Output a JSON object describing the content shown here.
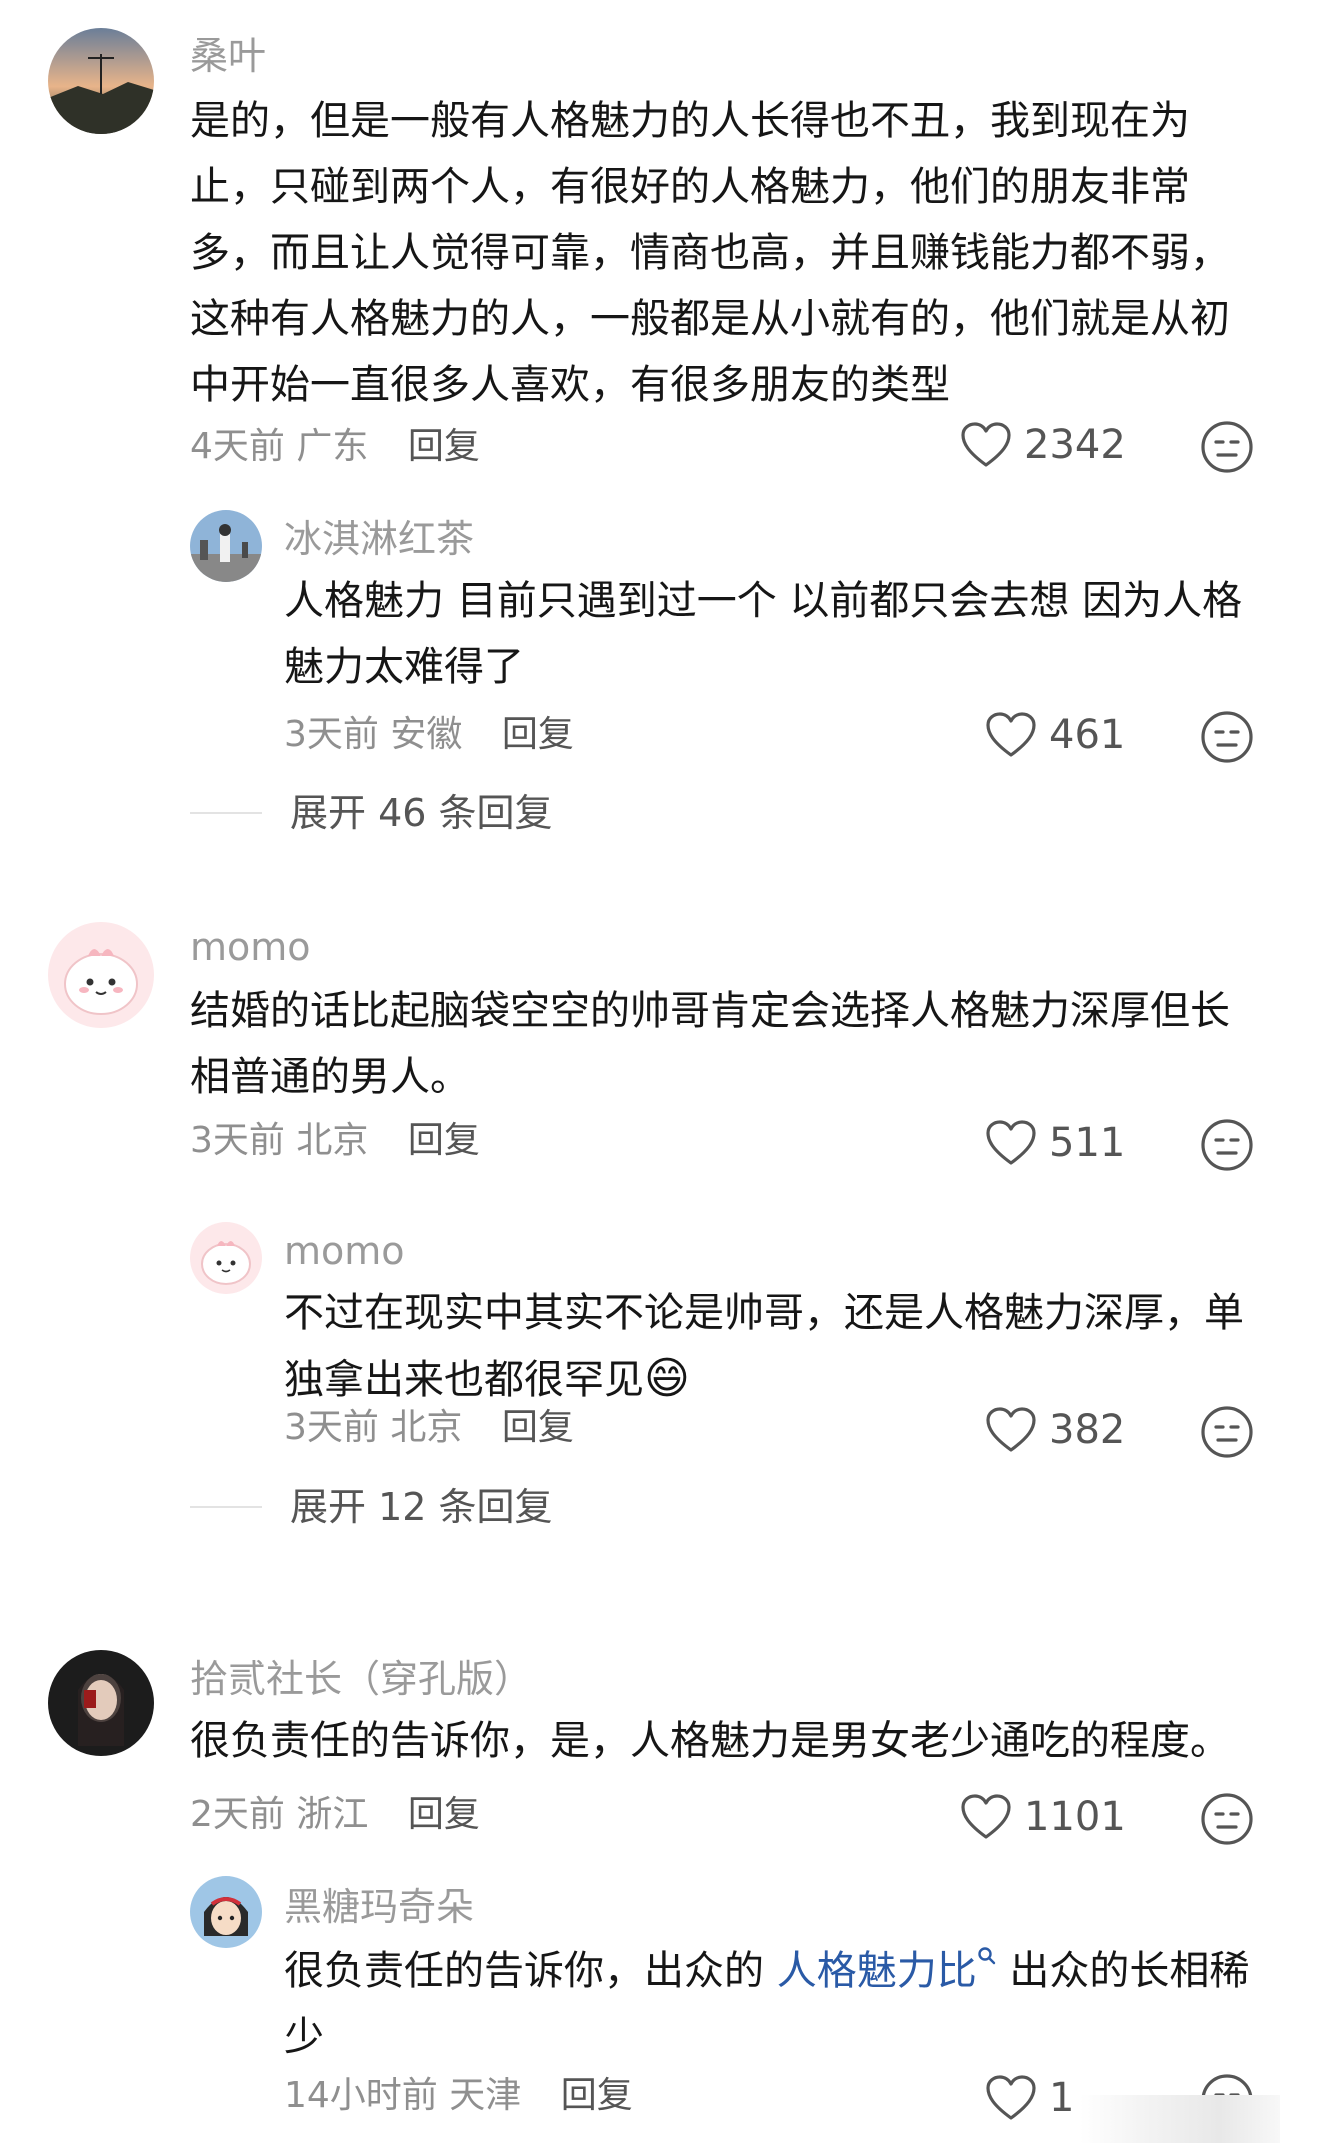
{
  "comments": [
    {
      "username": "桑叶",
      "content": "是的，但是一般有人格魅力的人长得也不丑，我到现在为止，只碰到两个人，有很好的人格魅力，他们的朋友非常多，而且让人觉得可靠，情商也高，并且赚钱能力都不弱，这种有人格魅力的人，一般都是从小就有的，他们就是从初中开始一直很多人喜欢，有很多朋友的类型",
      "time": "4天前",
      "location": "广东",
      "reply_label": "回复",
      "likes": "2342",
      "replies": [
        {
          "username": "冰淇淋红茶",
          "content": "人格魅力 目前只遇到过一个 以前都只会去想 因为人格魅力太难得了",
          "time": "3天前",
          "location": "安徽",
          "reply_label": "回复",
          "likes": "461"
        }
      ],
      "expand_label": "展开 46 条回复"
    },
    {
      "username": "momo",
      "content": "结婚的话比起脑袋空空的帅哥肯定会选择人格魅力深厚但长相普通的男人。",
      "time": "3天前",
      "location": "北京",
      "reply_label": "回复",
      "likes": "511",
      "replies": [
        {
          "username": "momo",
          "content": "不过在现实中其实不论是帅哥，还是人格魅力深厚，单独拿出来也都很罕见",
          "emoji": "😄",
          "time": "3天前",
          "location": "北京",
          "reply_label": "回复",
          "likes": "382"
        }
      ],
      "expand_label": "展开 12 条回复"
    },
    {
      "username": "拾贰社长（穿孔版）",
      "content": "很负责任的告诉你，是，人格魅力是男女老少通吃的程度。",
      "time": "2天前",
      "location": "浙江",
      "reply_label": "回复",
      "likes": "1101",
      "replies": [
        {
          "username": "黑糖玛奇朵",
          "content_before": "很负责任的告诉你，出众的 ",
          "content_link": "人格魅力比",
          "content_after": " 出众的长相稀少",
          "time": "14小时前",
          "location": "天津",
          "reply_label": "回复",
          "likes": "1"
        }
      ]
    }
  ],
  "icons": {
    "like": "heart-outline-icon",
    "dislike": "meh-face-icon",
    "search": "search-icon"
  },
  "colors": {
    "text": "#161616",
    "meta": "#8f8f8f",
    "username": "#9a9a9a",
    "link": "#2a5aa6"
  }
}
